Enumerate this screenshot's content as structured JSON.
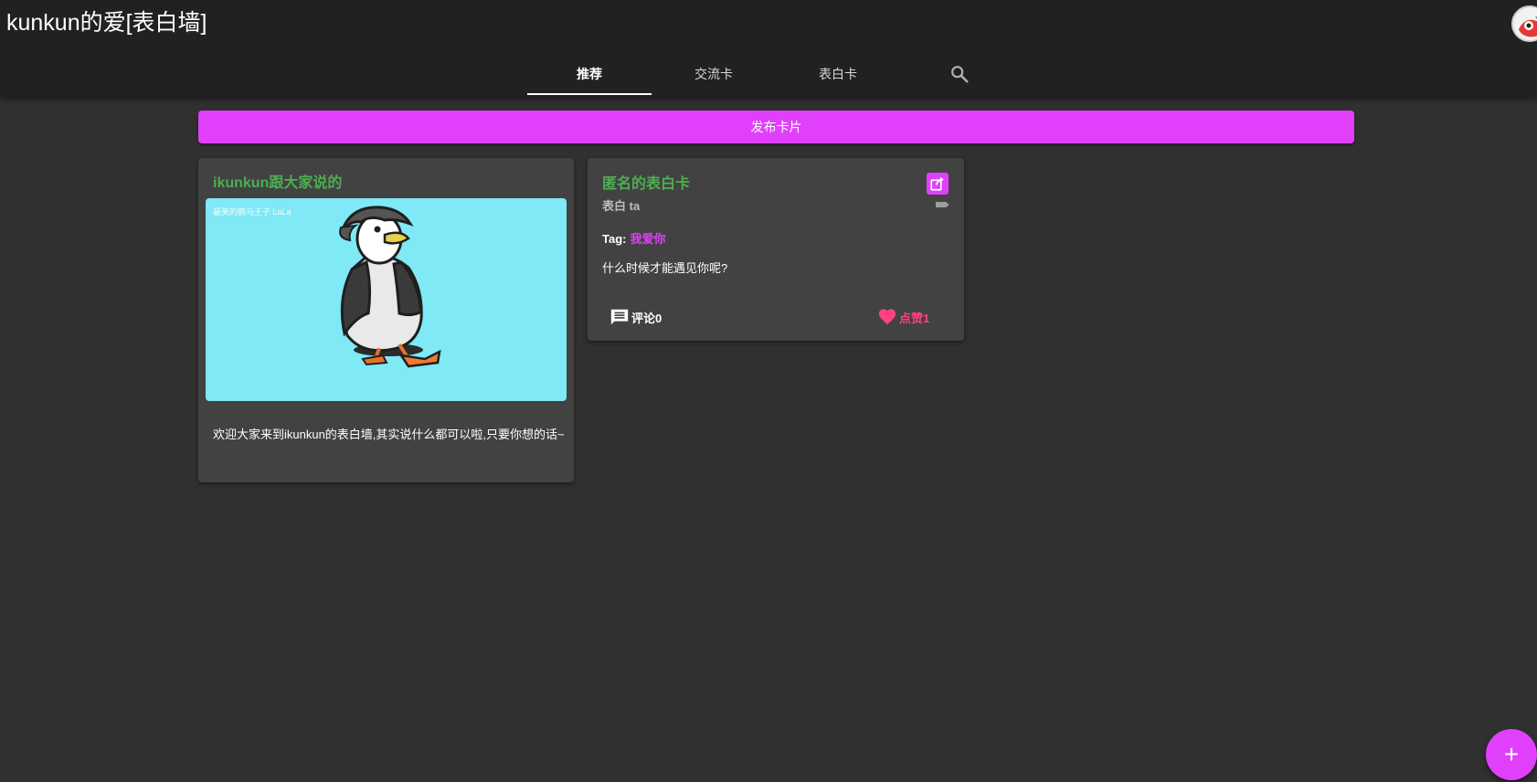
{
  "app": {
    "title": "kunkun的爱[表白墙]"
  },
  "nav": {
    "tabs": [
      {
        "label": "推荐",
        "active": true
      },
      {
        "label": "交流卡",
        "active": false
      },
      {
        "label": "表白卡",
        "active": false
      }
    ],
    "search_icon": "search-icon"
  },
  "publish": {
    "label": "发布卡片"
  },
  "cards": [
    {
      "title": "ikunkun跟大家说的",
      "image_watermark": "最美的鹅马王子 LaLa",
      "text": "欢迎大家来到ikunkun的表白墙,其实说什么都可以啦,只要你想的话~"
    },
    {
      "title": "匿名的表白卡",
      "subtitle": "表白 ta",
      "tag_label": "Tag:",
      "tag_value": "我爱你",
      "text": "什么时候才能遇见你呢?",
      "comment_label": "评论0",
      "like_label": "点赞1"
    }
  ],
  "fab": {
    "label": "+"
  },
  "colors": {
    "accent": "#e040fb",
    "title_green": "#4caf50",
    "like_pink": "#ff4081",
    "topbar": "#212121",
    "background": "#303030",
    "card": "#424242"
  }
}
